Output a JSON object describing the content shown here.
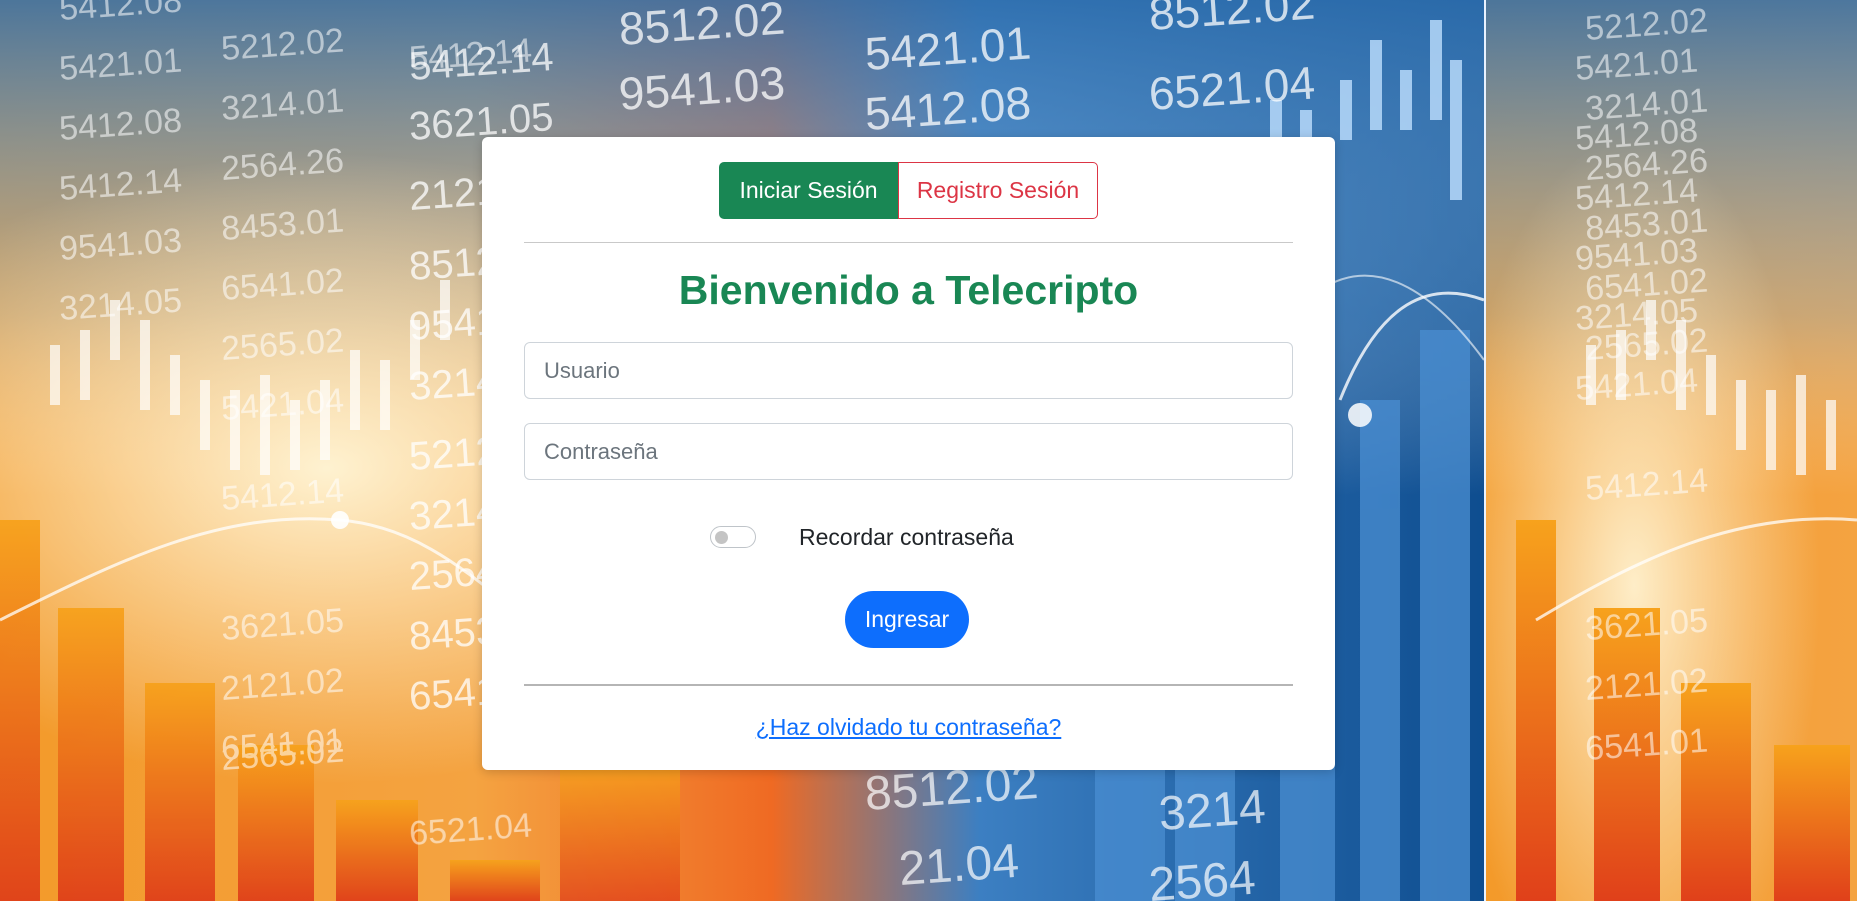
{
  "background": {
    "ticker_left": [
      "5412.08",
      "5212.02",
      "5421.01",
      "5412.14",
      "3214.01",
      "5412.08",
      "2564.26",
      "5412.14",
      "8453.01",
      "9541.03",
      "6541.02",
      "3214.05",
      "2565.02",
      "5421.04",
      "5412.14",
      "3621.05",
      "2121.02",
      "6541.01",
      "2565.02",
      "6521.04"
    ],
    "ticker_mid": [
      "5412.14",
      "3621.05",
      "2121",
      "8512",
      "9541",
      "3214",
      "5212",
      "3214",
      "2564",
      "8453",
      "6541"
    ],
    "ticker_top": [
      "8512.02",
      "9541.03",
      "5421.01",
      "5412.08",
      "8512.02",
      "6521.04"
    ],
    "ticker_bottom": [
      "8512.02",
      "21.04",
      "3214",
      "2564"
    ],
    "ticker_right": [
      "5212.02",
      "5421.01",
      "3214.01",
      "5412.08",
      "2564.26",
      "5412.14",
      "8453.01",
      "9541.03",
      "6541.02",
      "3214.05",
      "2565.02",
      "5421.04",
      "5412.14",
      "3621.05",
      "2121.02",
      "6541.01"
    ]
  },
  "tabs": {
    "login_label": "Iniciar Sesión",
    "register_label": "Registro Sesión"
  },
  "welcome_title": "Bienvenido a Telecripto",
  "form": {
    "username_placeholder": "Usuario",
    "password_placeholder": "Contraseña",
    "remember_label": "Recordar contraseña",
    "remember_checked": false,
    "submit_label": "Ingresar"
  },
  "forgot_password_link": "¿Haz olvidado tu contraseña?",
  "colors": {
    "success": "#198754",
    "danger": "#dc3545",
    "primary": "#0d6efd"
  }
}
